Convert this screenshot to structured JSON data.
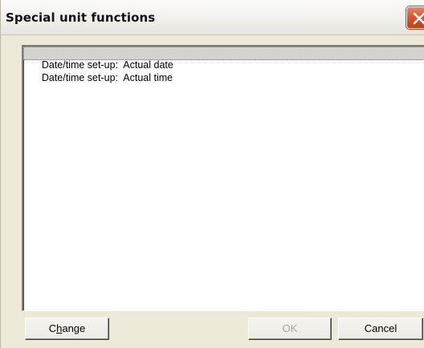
{
  "window": {
    "title": "Special unit functions"
  },
  "list": {
    "items": [
      {
        "label": "Date/time set-up:  Actual date",
        "selected": true
      },
      {
        "label": "Date/time set-up:  Actual time",
        "selected": false
      }
    ]
  },
  "buttons": {
    "change_first": "C",
    "change_underlined": "h",
    "change_rest": "ange",
    "ok_label": "OK",
    "cancel_label": "Cancel"
  },
  "colors": {
    "dialog_face": "#ece9d8",
    "selection": "#d4d3cf",
    "close_button": "#d9532f",
    "disabled_text": "#a8a69c"
  }
}
